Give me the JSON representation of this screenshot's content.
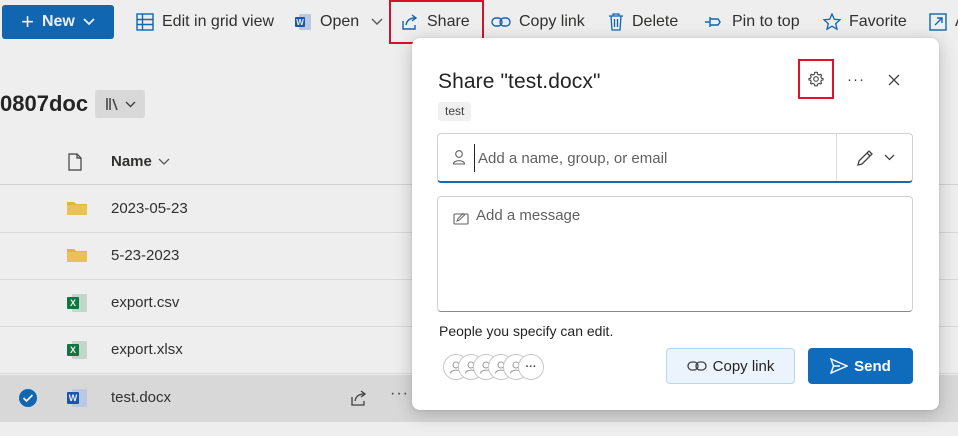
{
  "toolbar": {
    "new_label": "New",
    "edit_grid_label": "Edit in grid view",
    "open_label": "Open",
    "share_label": "Share",
    "copy_link_label": "Copy link",
    "delete_label": "Delete",
    "pin_label": "Pin to top",
    "favorite_label": "Favorite",
    "truncated_label": "A"
  },
  "library": {
    "title": "0807doc",
    "name_column": "Name",
    "rows": [
      {
        "name": "2023-05-23",
        "icon": "folder-icon"
      },
      {
        "name": "5-23-2023",
        "icon": "folder-icon"
      },
      {
        "name": "export.csv",
        "icon": "excel-file-icon"
      },
      {
        "name": "export.xlsx",
        "icon": "excel-file-icon"
      },
      {
        "name": "test.docx",
        "icon": "word-file-icon",
        "selected": true
      }
    ]
  },
  "dialog": {
    "title": "Share \"test.docx\"",
    "file_chip": "test",
    "people_placeholder": "Add a name, group, or email",
    "message_placeholder": "Add a message",
    "permission_text": "People you specify can edit.",
    "avatar_more": "···",
    "copy_link_label": "Copy link",
    "send_label": "Send"
  },
  "colors": {
    "accent": "#0f6cbd",
    "highlight": "#e3112c",
    "folder": "#f4bf3f",
    "excel": "#107c41",
    "word": "#185abd"
  }
}
